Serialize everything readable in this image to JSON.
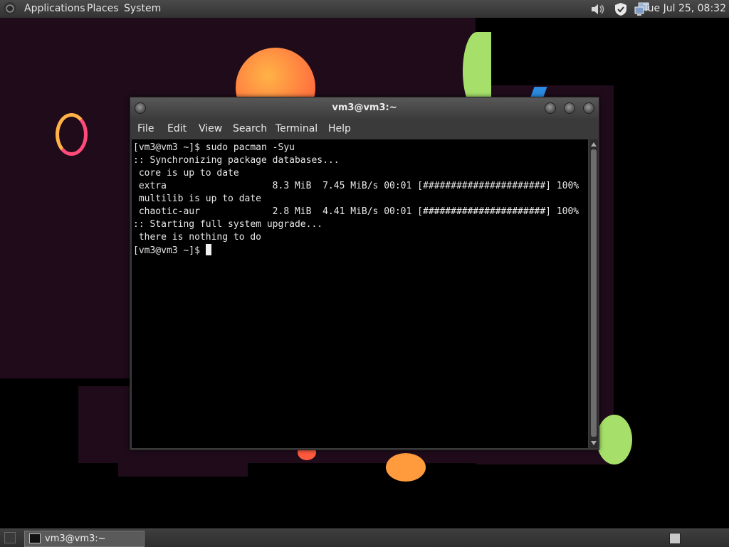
{
  "top_panel": {
    "menus": [
      "Applications",
      "Places",
      "System"
    ],
    "tray_icons": [
      "volume-icon",
      "shield-icon",
      "network-icon"
    ],
    "clock": "Tue Jul 25, 08:32"
  },
  "terminal": {
    "title": "vm3@vm3:~",
    "menu": [
      "File",
      "Edit",
      "View",
      "Search",
      "Terminal",
      "Help"
    ],
    "lines": [
      "[vm3@vm3 ~]$ sudo pacman -Syu",
      ":: Synchronizing package databases...",
      " core is up to date",
      " extra                   8.3 MiB  7.45 MiB/s 00:01 [######################] 100%",
      " multilib is up to date",
      " chaotic-aur             2.8 MiB  4.41 MiB/s 00:01 [######################] 100%",
      ":: Starting full system upgrade...",
      " there is nothing to do"
    ],
    "prompt": "[vm3@vm3 ~]$ "
  },
  "bottom_panel": {
    "task_label": "vm3@vm3:~"
  },
  "colors": {
    "wallpaper": "#1f0b1a",
    "terminal_bg": "#000000",
    "terminal_fg": "#e8e8e8"
  }
}
